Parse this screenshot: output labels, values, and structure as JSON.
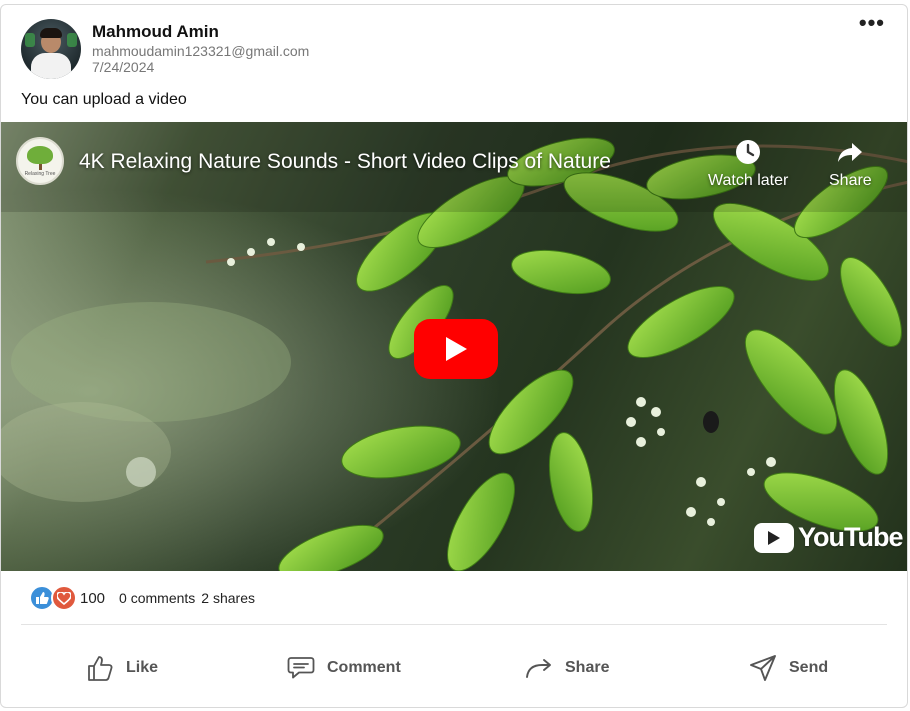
{
  "post": {
    "author": "Mahmoud Amin",
    "email": "mahmoudamin123321@gmail.com",
    "date": "7/24/2024",
    "text": "You can upload a video",
    "more_label": "•••"
  },
  "video": {
    "title": "4K Relaxing Nature Sounds - Short Video Clips of Nature",
    "channel_logo_caption": "Relaxing Tree",
    "watch_later_label": "Watch later",
    "share_label": "Share",
    "youtube_logo_text": "YouTube",
    "play_button_color": "#ff0000"
  },
  "stats": {
    "reaction_count": "100",
    "comments": "0 comments",
    "shares": "2 shares"
  },
  "actions": {
    "like": "Like",
    "comment": "Comment",
    "share": "Share",
    "send": "Send"
  },
  "colors": {
    "like_reaction": "#3b8fd9",
    "love_reaction": "#e0593d",
    "action_text": "#555555"
  }
}
